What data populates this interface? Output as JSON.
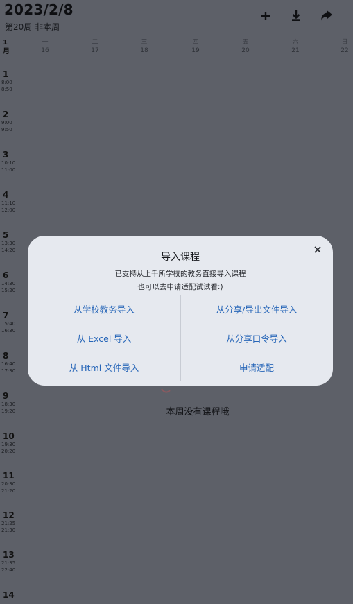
{
  "header": {
    "date": "2023/2/8",
    "week_info": "第20周  非本周"
  },
  "icons": {
    "add": "plus-icon",
    "download": "download-icon",
    "share": "share-icon"
  },
  "timetable": {
    "month": {
      "num": "1",
      "unit": "月"
    },
    "days": [
      {
        "label": "一",
        "date": "16"
      },
      {
        "label": "二",
        "date": "17"
      },
      {
        "label": "三",
        "date": "18"
      },
      {
        "label": "四",
        "date": "19"
      },
      {
        "label": "五",
        "date": "20"
      },
      {
        "label": "六",
        "date": "21"
      },
      {
        "label": "日",
        "date": "22"
      }
    ],
    "periods": [
      {
        "num": "1",
        "start": "8:00",
        "end": "8:50"
      },
      {
        "num": "2",
        "start": "9:00",
        "end": "9:50"
      },
      {
        "num": "3",
        "start": "10:10",
        "end": "11:00"
      },
      {
        "num": "4",
        "start": "11:10",
        "end": "12:00"
      },
      {
        "num": "5",
        "start": "13:30",
        "end": "14:20"
      },
      {
        "num": "6",
        "start": "14:30",
        "end": "15:20"
      },
      {
        "num": "7",
        "start": "15:40",
        "end": "16:30"
      },
      {
        "num": "8",
        "start": "16:40",
        "end": "17:30"
      },
      {
        "num": "9",
        "start": "18:30",
        "end": "19:20"
      },
      {
        "num": "10",
        "start": "19:30",
        "end": "20:20"
      },
      {
        "num": "11",
        "start": "20:30",
        "end": "21:20"
      },
      {
        "num": "12",
        "start": "21:25",
        "end": "21:30"
      },
      {
        "num": "13",
        "start": "21:35",
        "end": "22:40"
      },
      {
        "num": "14",
        "start": "",
        "end": ""
      }
    ],
    "empty_text": "本周没有课程哦"
  },
  "dialog": {
    "title": "导入课程",
    "desc_line1": "已支持从上千所学校的教务直接导入课程",
    "desc_line2": "也可以去申请适配试试看:)",
    "options": {
      "school": "从学校教务导入",
      "share_file": "从分享/导出文件导入",
      "excel": "从 Excel 导入",
      "share_code": "从分享口令导入",
      "html": "从 Html 文件导入",
      "apply": "申请适配"
    }
  },
  "colors": {
    "overlay": "#5d6068",
    "dialog_bg": "#e6e9ef",
    "link": "#2766b8"
  }
}
